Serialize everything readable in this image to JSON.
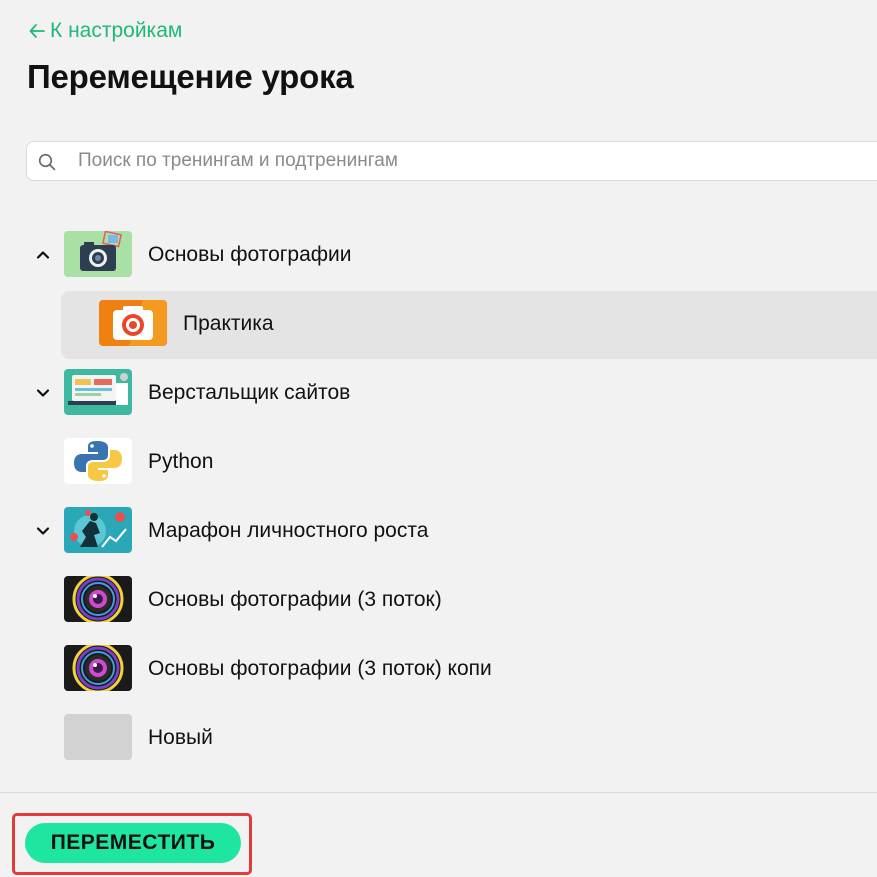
{
  "header": {
    "back_label": "К настройкам",
    "title": "Перемещение урока"
  },
  "search": {
    "placeholder": "Поиск по тренингам и подтренингам",
    "value": ""
  },
  "tree": {
    "items": [
      {
        "label": "Основы фотографии",
        "expanded": true,
        "icon": "camera-blue-thumb"
      },
      {
        "label": "Практика",
        "selected": true,
        "icon": "camera-orange-thumb"
      },
      {
        "label": "Верстальщик сайтов",
        "expanded": false,
        "icon": "web-design-thumb"
      },
      {
        "label": "Python",
        "icon": "python-logo-thumb"
      },
      {
        "label": "Марафон личностного роста",
        "expanded": false,
        "icon": "growth-marathon-thumb"
      },
      {
        "label": "Основы фотографии (3 поток)",
        "icon": "camera-lens-thumb"
      },
      {
        "label": "Основы фотографии (3 поток) копи",
        "icon": "camera-lens-thumb"
      },
      {
        "label": "Новый",
        "icon": "empty-thumb"
      }
    ]
  },
  "footer": {
    "move_label": "ПЕРЕМЕСТИТЬ"
  },
  "colors": {
    "accent": "#1fb87a",
    "button": "#1ee6a0",
    "highlight": "#e03c3c",
    "selected_bg": "#e4e4e4"
  }
}
